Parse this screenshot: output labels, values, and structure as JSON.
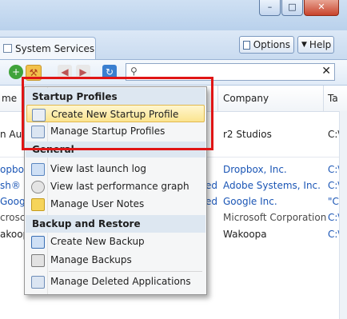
{
  "tab": {
    "label": "System Services"
  },
  "header_buttons": {
    "options_label": "Options",
    "help_label": "Help"
  },
  "toolbar": {
    "clear_label": "✕"
  },
  "columns": {
    "company": "Company",
    "name_partial": "me",
    "target_partial": "Ta"
  },
  "rows": [
    {
      "left": "n Au",
      "company": "r2 Studios",
      "target": "C:\\"
    },
    {
      "left": "opbo",
      "mid": "",
      "company": "Dropbox, Inc.",
      "target": "C:\\"
    },
    {
      "left": "sh®",
      "mid": "ed",
      "company": "Adobe Systems, Inc.",
      "target": "C:\\"
    },
    {
      "left": "Googl",
      "mid": "ed",
      "company": "Google Inc.",
      "target": "\"C"
    },
    {
      "left": "crosc",
      "mid": "",
      "company": "Microsoft Corporation",
      "target": "C:\\"
    },
    {
      "left": "akoop",
      "mid": "",
      "company": "Wakoopa",
      "target": "C:\\"
    }
  ],
  "menu": {
    "startup_header": "Startup Profiles",
    "create_profile": "Create New Startup Profile",
    "manage_profiles": "Manage Startup Profiles",
    "general_header": "General",
    "view_launch_log": "View last launch log",
    "view_perf_graph": "View last performance graph",
    "manage_user_notes": "Manage User Notes",
    "backup_header": "Backup and Restore",
    "create_backup": "Create New Backup",
    "manage_backups": "Manage Backups",
    "manage_deleted": "Manage Deleted Applications"
  },
  "colors": {
    "highlight_border": "#e01515",
    "link_blue": "#1a55b5",
    "menu_highlight": "#fbe48f"
  }
}
